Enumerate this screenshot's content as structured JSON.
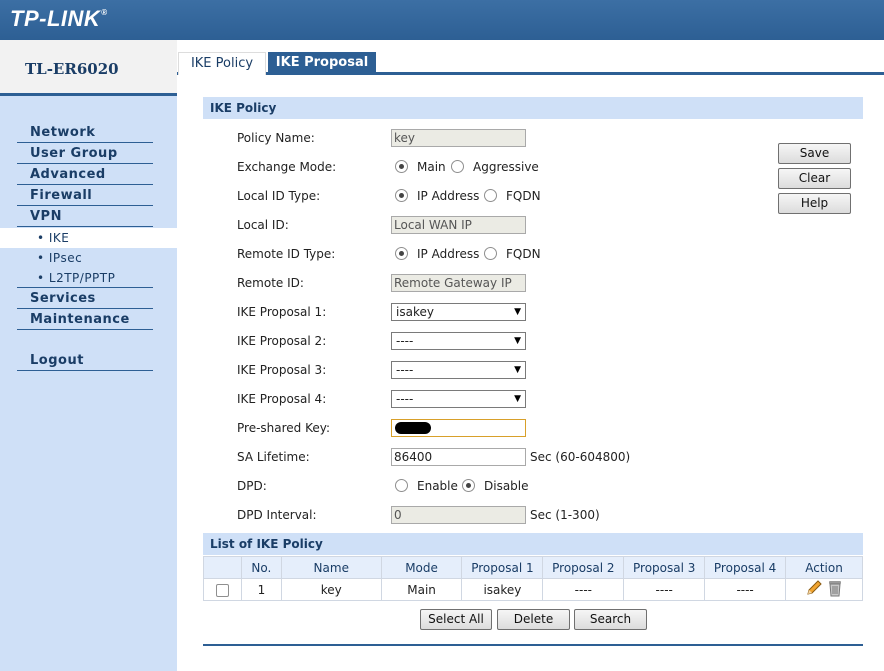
{
  "brand": {
    "logo": "TP-LINK",
    "trademark": "®",
    "model": "TL-ER6020"
  },
  "sidebar": {
    "items": [
      {
        "label": "Network"
      },
      {
        "label": "User Group"
      },
      {
        "label": "Advanced"
      },
      {
        "label": "Firewall"
      },
      {
        "label": "VPN"
      },
      {
        "label": "• IKE"
      },
      {
        "label": "• IPsec"
      },
      {
        "label": "• L2TP/PPTP"
      },
      {
        "label": "Services"
      },
      {
        "label": "Maintenance"
      },
      {
        "label": "Logout"
      }
    ]
  },
  "tabs": [
    {
      "label": "IKE Policy"
    },
    {
      "label": "IKE Proposal"
    }
  ],
  "form": {
    "section_title": "IKE Policy",
    "policy_name": {
      "label": "Policy Name:",
      "value": "key"
    },
    "exchange_mode": {
      "label": "Exchange Mode:",
      "options": [
        "Main",
        "Aggressive"
      ],
      "selected": "Main"
    },
    "local_id_type": {
      "label": "Local ID Type:",
      "options": [
        "IP Address",
        "FQDN"
      ],
      "selected": "IP Address"
    },
    "local_id": {
      "label": "Local ID:",
      "value": "Local WAN IP"
    },
    "remote_id_type": {
      "label": "Remote ID Type:",
      "options": [
        "IP Address",
        "FQDN"
      ],
      "selected": "IP Address"
    },
    "remote_id": {
      "label": "Remote ID:",
      "value": "Remote Gateway IP"
    },
    "proposal1": {
      "label": "IKE Proposal 1:",
      "value": "isakey"
    },
    "proposal2": {
      "label": "IKE Proposal 2:",
      "value": "----"
    },
    "proposal3": {
      "label": "IKE Proposal 3:",
      "value": "----"
    },
    "proposal4": {
      "label": "IKE Proposal 4:",
      "value": "----"
    },
    "psk": {
      "label": "Pre-shared Key:"
    },
    "sa_lifetime": {
      "label": "SA Lifetime:",
      "value": "86400",
      "hint": "Sec (60-604800)"
    },
    "dpd": {
      "label": "DPD:",
      "options": [
        "Enable",
        "Disable"
      ],
      "selected": "Disable"
    },
    "dpd_interval": {
      "label": "DPD Interval:",
      "value": "0",
      "hint": "Sec (1-300)"
    }
  },
  "actions": {
    "save": "Save",
    "clear": "Clear",
    "help": "Help"
  },
  "list": {
    "title": "List of IKE Policy",
    "columns": [
      "",
      "No.",
      "Name",
      "Mode",
      "Proposal 1",
      "Proposal 2",
      "Proposal 3",
      "Proposal 4",
      "Action"
    ],
    "rows": [
      {
        "no": "1",
        "name": "key",
        "mode": "Main",
        "p1": "isakey",
        "p2": "----",
        "p3": "----",
        "p4": "----"
      }
    ]
  },
  "list_actions": {
    "select_all": "Select All",
    "delete": "Delete",
    "search": "Search"
  },
  "icons": {
    "edit": "pencil-icon",
    "delete": "trash-icon"
  },
  "colors": {
    "brand_blue": "#2d5f94",
    "sidebar_bg": "#cfe0f7",
    "header_text": "#1a3d66"
  }
}
